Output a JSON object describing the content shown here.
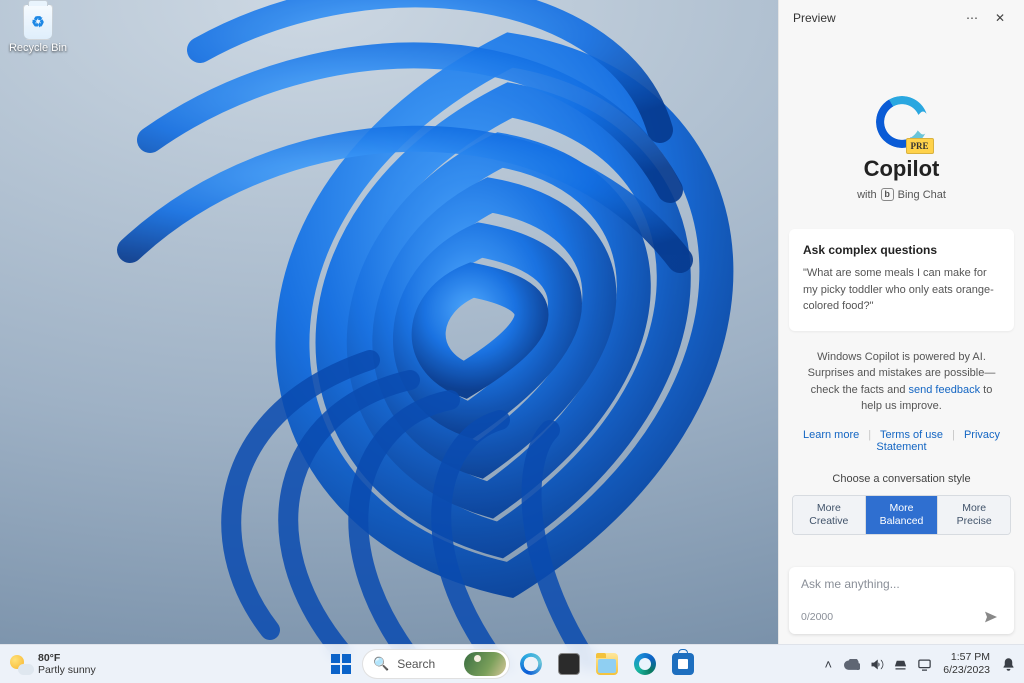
{
  "desktop": {
    "recycle_bin_label": "Recycle Bin"
  },
  "copilot": {
    "header_title": "Preview",
    "brand_title": "Copilot",
    "brand_sub_prefix": "with",
    "brand_sub_product": "Bing Chat",
    "pre_badge": "PRE",
    "card": {
      "title": "Ask complex questions",
      "example": "\"What are some meals I can make for my picky toddler who only eats orange-colored food?\""
    },
    "disclaimer_pre": "Windows Copilot is powered by AI. Surprises and mistakes are possible—check the facts and ",
    "disclaimer_link": "send feedback",
    "disclaimer_post": " to help us improve.",
    "links": {
      "learn": "Learn more",
      "terms": "Terms of use",
      "privacy": "Privacy Statement"
    },
    "style_title": "Choose a conversation style",
    "styles": {
      "creative_top": "More",
      "creative_bottom": "Creative",
      "balanced_top": "More",
      "balanced_bottom": "Balanced",
      "precise_top": "More",
      "precise_bottom": "Precise"
    },
    "input": {
      "placeholder": "Ask me anything...",
      "counter": "0/2000"
    }
  },
  "taskbar": {
    "weather": {
      "temp": "80°F",
      "cond": "Partly sunny"
    },
    "search_placeholder": "Search",
    "clock": {
      "time": "1:57 PM",
      "date": "6/23/2023"
    }
  }
}
